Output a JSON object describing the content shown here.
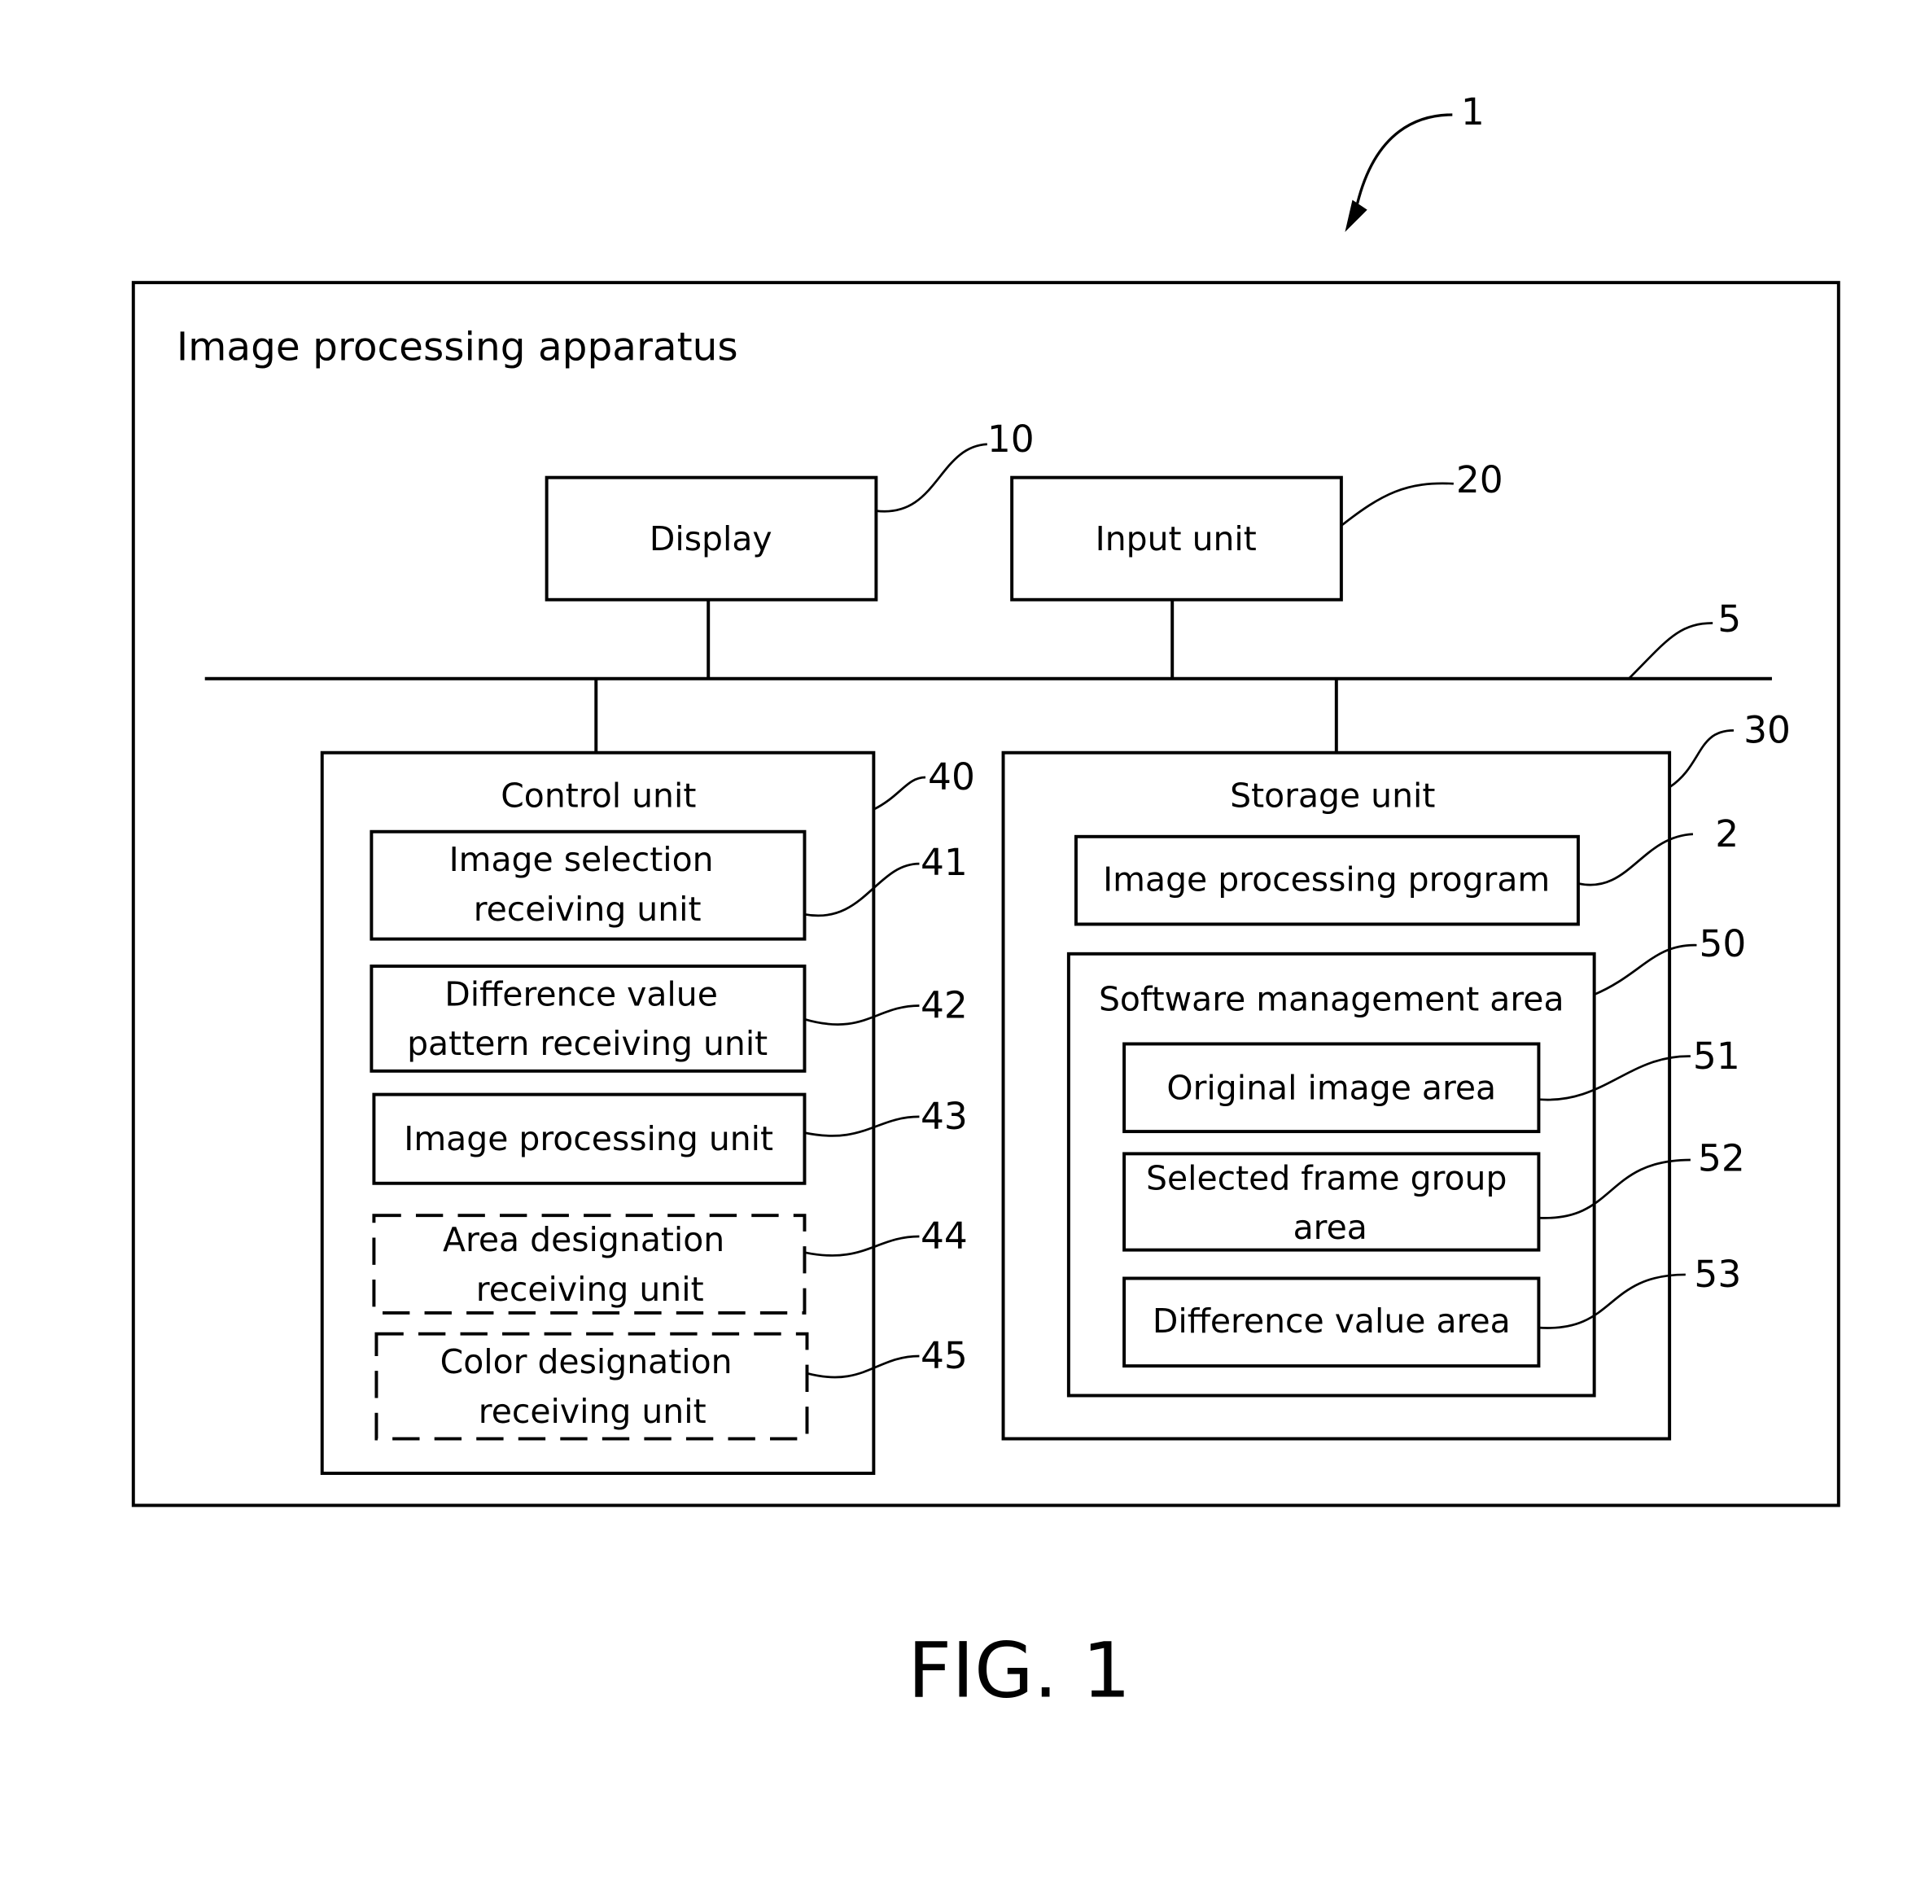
{
  "figure": {
    "caption": "FIG. 1",
    "apparatus_ref": "1",
    "apparatus_title": "Image processing apparatus"
  },
  "bus": {
    "ref": "5"
  },
  "display": {
    "label": "Display",
    "ref": "10"
  },
  "input_unit": {
    "label": "Input unit",
    "ref": "20"
  },
  "control_unit": {
    "label": "Control unit",
    "ref": "40",
    "items": [
      {
        "lines": [
          "Image selection",
          "receiving unit"
        ],
        "ref": "41",
        "style": "solid"
      },
      {
        "lines": [
          "Difference value",
          "pattern receiving unit"
        ],
        "ref": "42",
        "style": "solid"
      },
      {
        "lines": [
          "Image processing unit"
        ],
        "ref": "43",
        "style": "solid"
      },
      {
        "lines": [
          "Area designation",
          "receiving unit"
        ],
        "ref": "44",
        "style": "dashed"
      },
      {
        "lines": [
          "Color designation",
          "receiving unit"
        ],
        "ref": "45",
        "style": "dashed"
      }
    ]
  },
  "storage_unit": {
    "label": "Storage unit",
    "ref": "30",
    "program": {
      "label": "Image processing program",
      "ref": "2"
    },
    "software_area": {
      "label": "Software management area",
      "ref": "50",
      "items": [
        {
          "lines": [
            "Original image area"
          ],
          "ref": "51"
        },
        {
          "lines": [
            "Selected frame group",
            "area"
          ],
          "ref": "52"
        },
        {
          "lines": [
            "Difference value area"
          ],
          "ref": "53"
        }
      ]
    }
  }
}
